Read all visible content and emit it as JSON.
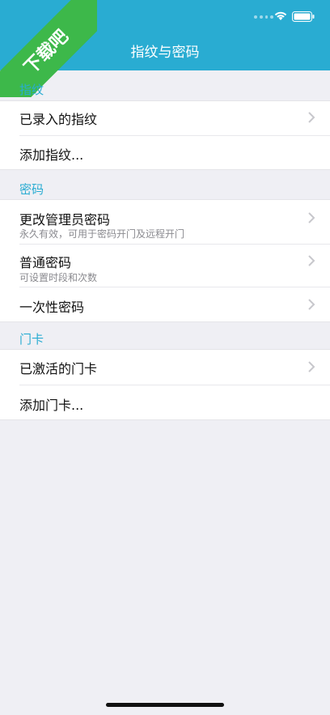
{
  "watermark": {
    "text": "下载吧"
  },
  "header": {
    "title": "指纹与密码"
  },
  "sections": [
    {
      "title": "指纹",
      "items": [
        {
          "label": "已录入的指纹",
          "chevron": true
        },
        {
          "label": "添加指纹...",
          "chevron": false
        }
      ]
    },
    {
      "title": "密码",
      "items": [
        {
          "label": "更改管理员密码",
          "subtitle": "永久有效，可用于密码开门及远程开门",
          "chevron": true
        },
        {
          "label": "普通密码",
          "subtitle": "可设置时段和次数",
          "chevron": true
        },
        {
          "label": "一次性密码",
          "chevron": true
        }
      ]
    },
    {
      "title": "门卡",
      "items": [
        {
          "label": "已激活的门卡",
          "chevron": true
        },
        {
          "label": "添加门卡...",
          "chevron": false
        }
      ]
    }
  ],
  "colors": {
    "header": "#29acd2",
    "accent": "#29acd2",
    "background": "#efeff4"
  }
}
